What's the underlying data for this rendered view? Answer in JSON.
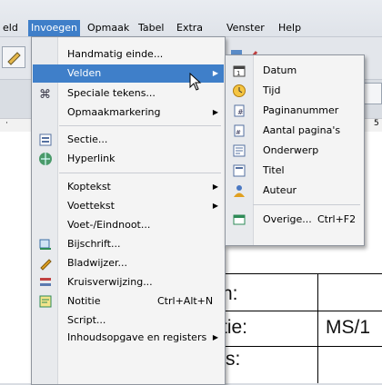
{
  "menubar": {
    "items": [
      {
        "label": "eld",
        "active": false
      },
      {
        "label": "Invoegen",
        "active": true
      },
      {
        "label": "Opmaak",
        "active": false
      },
      {
        "label": "Tabel",
        "active": false
      },
      {
        "label": "Extra",
        "active": false
      },
      {
        "label": "Venster",
        "active": false
      },
      {
        "label": "Help",
        "active": false
      }
    ]
  },
  "insert_menu": {
    "items": [
      {
        "label": "Handmatig einde...",
        "icon": ""
      },
      {
        "label": "Velden",
        "icon": "",
        "submenu": true,
        "highlighted": true
      },
      {
        "label": "Speciale tekens...",
        "icon": "special-chars-icon"
      },
      {
        "label": "Opmaakmarkering",
        "icon": "",
        "submenu": true
      },
      {
        "label": "Sectie...",
        "icon": "section-icon"
      },
      {
        "label": "Hyperlink",
        "icon": "hyperlink-icon"
      },
      {
        "label": "Koptekst",
        "icon": "",
        "submenu": true
      },
      {
        "label": "Voettekst",
        "icon": "",
        "submenu": true
      },
      {
        "label": "Voet-/Eindnoot...",
        "icon": ""
      },
      {
        "label": "Bijschrift...",
        "icon": "caption-icon"
      },
      {
        "label": "Bladwijzer...",
        "icon": "bookmark-icon"
      },
      {
        "label": "Kruisverwijzing...",
        "icon": "cross-reference-icon"
      },
      {
        "label": "Notitie",
        "icon": "note-icon",
        "shortcut": "Ctrl+Alt+N"
      },
      {
        "label": "Script...",
        "icon": ""
      },
      {
        "label": "Inhoudsopgave en registers",
        "icon": "",
        "submenu": true
      }
    ]
  },
  "fields_submenu": {
    "items": [
      {
        "label": "Datum",
        "icon": "calendar-icon"
      },
      {
        "label": "Tijd",
        "icon": "clock-icon"
      },
      {
        "label": "Paginanummer",
        "icon": "page-number-icon"
      },
      {
        "label": "Aantal pagina's",
        "icon": "page-count-icon"
      },
      {
        "label": "Onderwerp",
        "icon": "subject-icon"
      },
      {
        "label": "Titel",
        "icon": "title-icon"
      },
      {
        "label": "Auteur",
        "icon": "author-icon"
      },
      {
        "label": "Overige...",
        "icon": "other-fields-icon",
        "shortcut": "Ctrl+F2"
      }
    ]
  },
  "document": {
    "lines": [
      "n:",
      "tie:",
      "'s:"
    ],
    "cell_text": "MS/1"
  },
  "ruler": {
    "mark": "5"
  },
  "colors": {
    "accent": "#3f7fc9",
    "menu_bg": "#f4f4f4"
  }
}
